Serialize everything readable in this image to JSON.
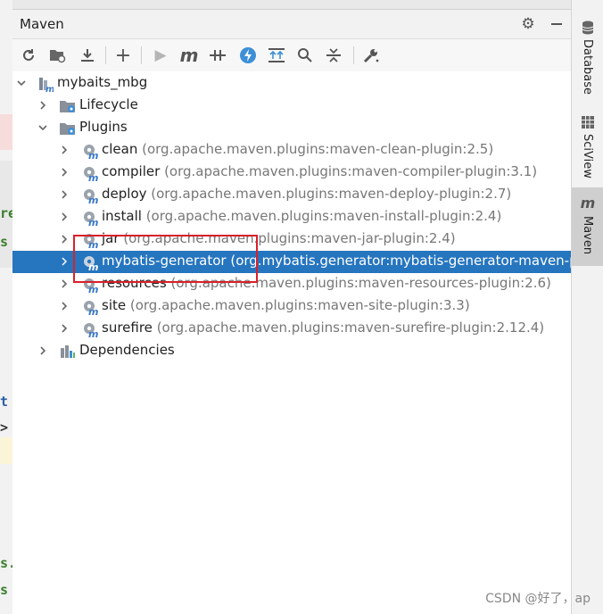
{
  "panel": {
    "title": "Maven"
  },
  "toolbar": {
    "buttons": [
      {
        "name": "reload-icon",
        "glyph": "⟳"
      },
      {
        "name": "generate-sources-icon",
        "glyph": "▣"
      },
      {
        "name": "download-icon",
        "glyph": "⤓"
      },
      {
        "name": "add-icon",
        "glyph": "+"
      },
      {
        "name": "run-icon",
        "glyph": "▶"
      },
      {
        "name": "execute-goal-icon",
        "glyph": "m"
      },
      {
        "name": "toggle-offline-icon",
        "glyph": "⫲"
      },
      {
        "name": "skip-tests-icon",
        "glyph": "ϟ"
      },
      {
        "name": "show-dependencies-icon",
        "glyph": "⇈"
      },
      {
        "name": "find-icon",
        "glyph": "⌕"
      },
      {
        "name": "collapse-all-icon",
        "glyph": "⇕"
      },
      {
        "name": "settings-wrench-icon",
        "glyph": "🔧"
      }
    ]
  },
  "tree": {
    "project": "mybaits_mbg",
    "lifecycle": "Lifecycle",
    "plugins_label": "Plugins",
    "plugins": [
      {
        "name": "clean",
        "coord": "(org.apache.maven.plugins:maven-clean-plugin:2.5)"
      },
      {
        "name": "compiler",
        "coord": "(org.apache.maven.plugins:maven-compiler-plugin:3.1)"
      },
      {
        "name": "deploy",
        "coord": "(org.apache.maven.plugins:maven-deploy-plugin:2.7)"
      },
      {
        "name": "install",
        "coord": "(org.apache.maven.plugins:maven-install-plugin:2.4)"
      },
      {
        "name": "jar",
        "coord": "(org.apache.maven.plugins:maven-jar-plugin:2.4)"
      },
      {
        "name": "mybatis-generator",
        "coord": "(org.mybatis.generator:mybatis-generator-maven-plu"
      },
      {
        "name": "resources",
        "coord": "(org.apache.maven.plugins:maven-resources-plugin:2.6)"
      },
      {
        "name": "site",
        "coord": "(org.apache.maven.plugins:maven-site-plugin:3.3)"
      },
      {
        "name": "surefire",
        "coord": "(org.apache.maven.plugins:maven-surefire-plugin:2.12.4)"
      }
    ],
    "dependencies": "Dependencies",
    "selected_plugin": "mybatis-generator"
  },
  "right_strip": {
    "tabs": [
      {
        "label": "Database",
        "icon": "database-icon",
        "active": false
      },
      {
        "label": "SciView",
        "icon": "sciview-icon",
        "active": false
      },
      {
        "label": "Maven",
        "icon": "maven-icon",
        "active": true
      }
    ]
  },
  "editor_strip": {
    "chars": [
      "re",
      "s",
      "t",
      ">",
      "s.",
      "s"
    ]
  },
  "watermark": "CSDN @好了，ap",
  "colors": {
    "selection": "#2675bf",
    "highlight_box": "#d9202a",
    "maven_m": "#3a78c9"
  }
}
